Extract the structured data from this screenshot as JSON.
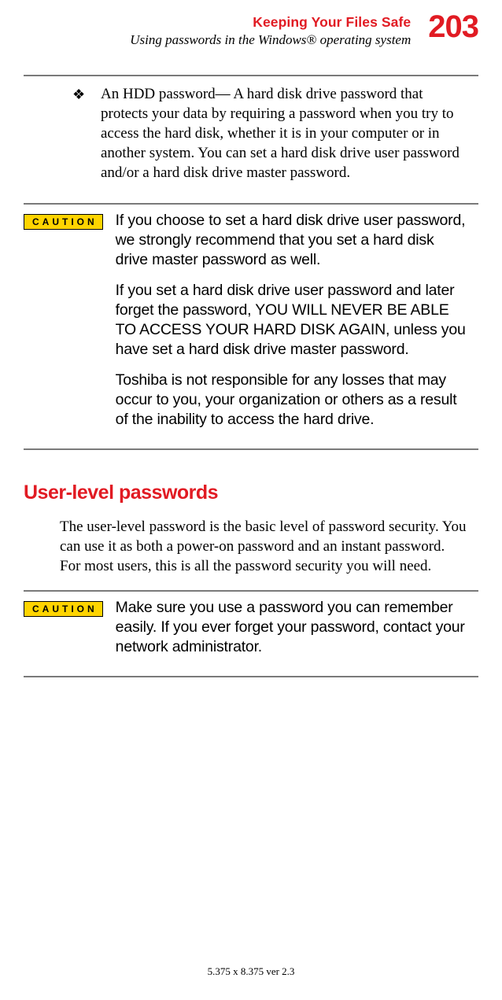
{
  "header": {
    "title": "Keeping Your Files Safe",
    "subtitle": "Using passwords in the Windows® operating system",
    "page_number": "203"
  },
  "bullet": {
    "glyph": "❖",
    "text": "An HDD password— A hard disk drive password that protects your data by requiring a password when you try to access the hard disk, whether it is in your computer or in another system. You can set a hard disk drive user password and/or a hard disk drive master password."
  },
  "caution1": {
    "label": "CAUTION",
    "para1": "If you choose to set a hard disk drive user password, we strongly recommend that you set a hard disk drive master password as well.",
    "para2": "If you set a hard disk drive user password and later forget the password, YOU WILL NEVER BE ABLE TO ACCESS YOUR HARD DISK AGAIN, unless you have set a hard disk drive master password.",
    "para3": "Toshiba is not responsible for any losses that may occur to you, your organization or others as a result of the inability to access the hard drive."
  },
  "section": {
    "title": "User-level passwords",
    "body": "The user-level password is the basic level of password security. You can use it as both a power-on password and an instant password. For most users, this is all the password security you will need."
  },
  "caution2": {
    "label": "CAUTION",
    "text": "Make sure you use a password you can remember easily. If you ever forget your password, contact your network administrator."
  },
  "footer": "5.375 x 8.375 ver 2.3"
}
